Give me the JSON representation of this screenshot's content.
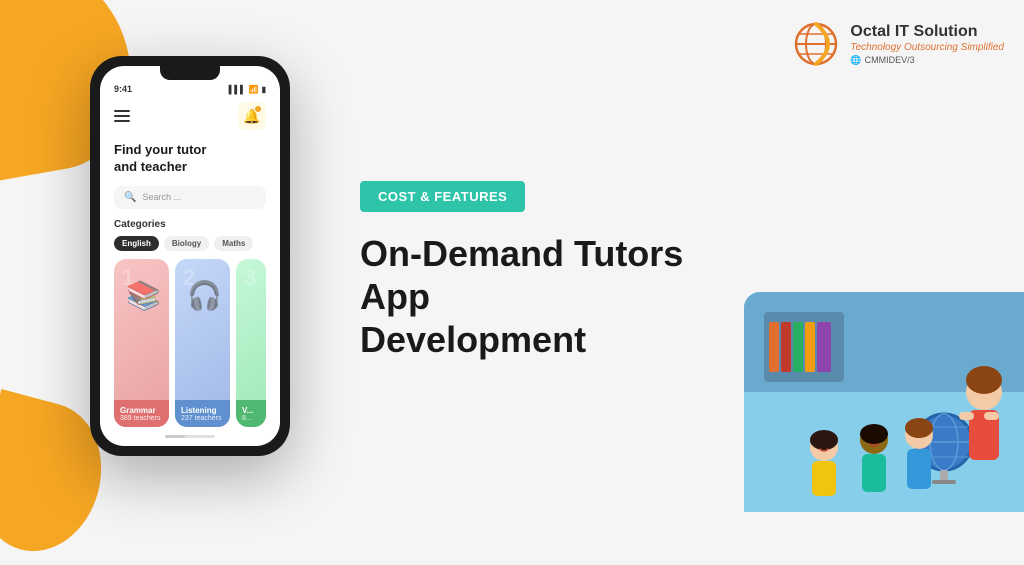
{
  "decorations": {
    "orange_shape_top": "orange accent shape",
    "orange_shape_bottom": "orange accent shape"
  },
  "phone": {
    "status_time": "9:41",
    "signal_icon": "▌▌▌",
    "wifi_icon": "wifi",
    "battery_icon": "🔋",
    "hero_title": "Find your tutor\nand teacher",
    "search_placeholder": "Search ...",
    "categories_label": "Categories",
    "category_tags": [
      {
        "label": "English",
        "active": true
      },
      {
        "label": "Biology",
        "active": false
      },
      {
        "label": "Maths",
        "active": false
      }
    ],
    "tutor_cards": [
      {
        "number": "1",
        "subject": "Grammar",
        "teachers": "389 teachers",
        "bg_class": "card-grammar"
      },
      {
        "number": "2",
        "subject": "Listening",
        "teachers": "237 teachers",
        "bg_class": "card-listening"
      },
      {
        "number": "3",
        "subject": "Vo...",
        "teachers": "8...",
        "bg_class": "card-vocab"
      }
    ]
  },
  "logo": {
    "company_name": "Octal IT Solution",
    "tagline": "Technology Outsourcing Simplified",
    "badge": "CMMIDEV/3"
  },
  "content": {
    "badge_text": "COST & FEATURES",
    "main_title_line1": "On-Demand Tutors App",
    "main_title_line2": "Development"
  },
  "colors": {
    "orange": "#F5A623",
    "teal": "#2EC4A9",
    "dark": "#1a1a1a",
    "logo_orange": "#e07030"
  }
}
